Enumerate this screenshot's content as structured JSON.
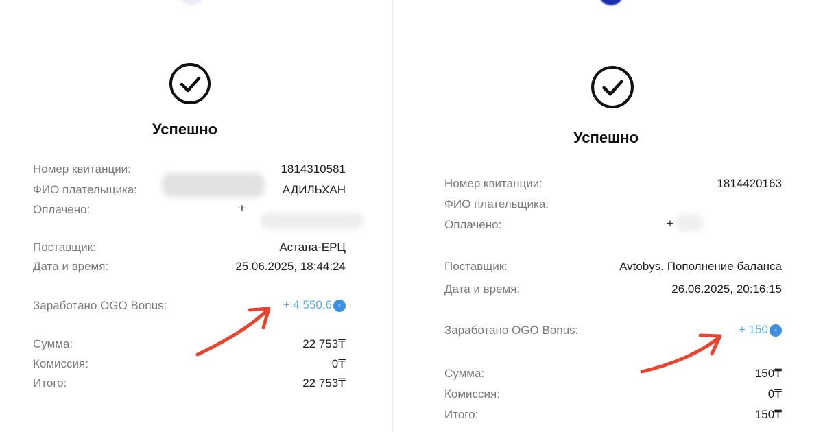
{
  "receipts": [
    {
      "status": "Успешно",
      "rows": {
        "receipt_no": {
          "label": "Номер квитанции:",
          "value": "1814310581"
        },
        "payer": {
          "label": "ФИО плательщика:",
          "value": "АДИЛЬХАН"
        },
        "paid": {
          "label": "Оплачено:",
          "value": "+"
        },
        "supplier": {
          "label": "Поставщик:",
          "value": "Астана-ЕРЦ"
        },
        "datetime": {
          "label": "Дата и время:",
          "value": "25.06.2025, 18:44:24"
        },
        "bonus": {
          "label": "Заработано OGO Bonus:",
          "value": "+ 4 550.6"
        },
        "sum": {
          "label": "Сумма:",
          "value": "22 753₸"
        },
        "commission": {
          "label": "Комиссия:",
          "value": "0₸"
        },
        "total": {
          "label": "Итого:",
          "value": "22 753₸"
        }
      }
    },
    {
      "status": "Успешно",
      "rows": {
        "receipt_no": {
          "label": "Номер квитанции:",
          "value": "1814420163"
        },
        "payer": {
          "label": "ФИО плательщика:",
          "value": ""
        },
        "paid": {
          "label": "Оплачено:",
          "value": "+"
        },
        "supplier": {
          "label": "Поставщик:",
          "value": "Avtobys. Пополнение баланса"
        },
        "datetime": {
          "label": "Дата и время:",
          "value": "26.06.2025, 20:16:15"
        },
        "bonus": {
          "label": "Заработано OGO Bonus:",
          "value": "+ 150"
        },
        "sum": {
          "label": "Сумма:",
          "value": "150₸"
        },
        "commission": {
          "label": "Комиссия:",
          "value": "0₸"
        },
        "total": {
          "label": "Итого:",
          "value": "150₸"
        }
      }
    }
  ],
  "colors": {
    "bonus_text": "#5aaee8",
    "coin_icon": "#3d8fe0",
    "annotation_arrow": "#e8452f"
  },
  "icons": [
    "check-circle-icon",
    "bonus-coin-icon",
    "red-arrow-annotation"
  ]
}
